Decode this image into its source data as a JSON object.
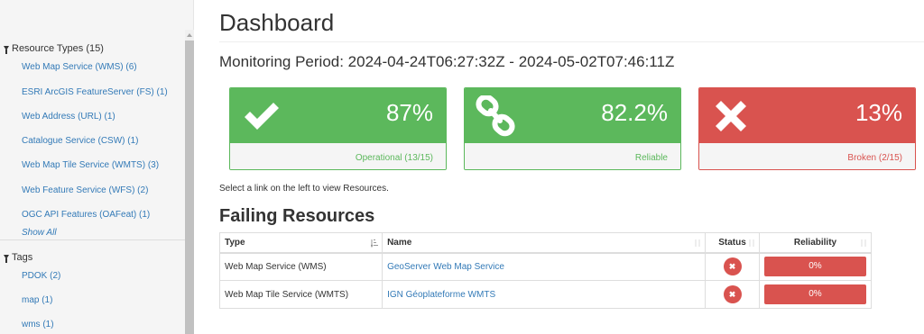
{
  "sidebar": {
    "resource_types_header": "Resource Types (15)",
    "resource_types": [
      "Web Map Service (WMS) (6)",
      "ESRI ArcGIS FeatureServer (FS) (1)",
      "Web Address (URL) (1)",
      "Catalogue Service (CSW) (1)",
      "Web Map Tile Service (WMTS) (3)",
      "Web Feature Service (WFS) (2)",
      "OGC API Features (OAFeat) (1)"
    ],
    "show_all": "Show All",
    "tags_header": "Tags",
    "tags": [
      "PDOK (2)",
      "map (1)",
      "wms (1)"
    ]
  },
  "main": {
    "title": "Dashboard",
    "monitoring_period": "Monitoring Period: 2024-04-24T06:27:32Z - 2024-05-02T07:46:11Z",
    "panels": [
      {
        "icon": "check-icon",
        "percent": "87%",
        "label": "Operational (13/15)",
        "color": "#5cb85c"
      },
      {
        "icon": "chain-link-icon",
        "percent": "82.2%",
        "label": "Reliable",
        "color": "#5cb85c"
      },
      {
        "icon": "times-icon",
        "percent": "13%",
        "label": "Broken (2/15)",
        "color": "#d9534f"
      }
    ],
    "hint": "Select a link on the left to view Resources.",
    "failing_title": "Failing Resources",
    "table": {
      "headers": [
        "Type",
        "Name",
        "Status",
        "Reliability"
      ],
      "rows": [
        {
          "type": "Web Map Service (WMS)",
          "name": "GeoServer Web Map Service",
          "status": "broken",
          "reliability": "0%"
        },
        {
          "type": "Web Map Tile Service (WMTS)",
          "name": "IGN Géoplateforme WMTS",
          "status": "broken",
          "reliability": "0%"
        }
      ]
    }
  }
}
